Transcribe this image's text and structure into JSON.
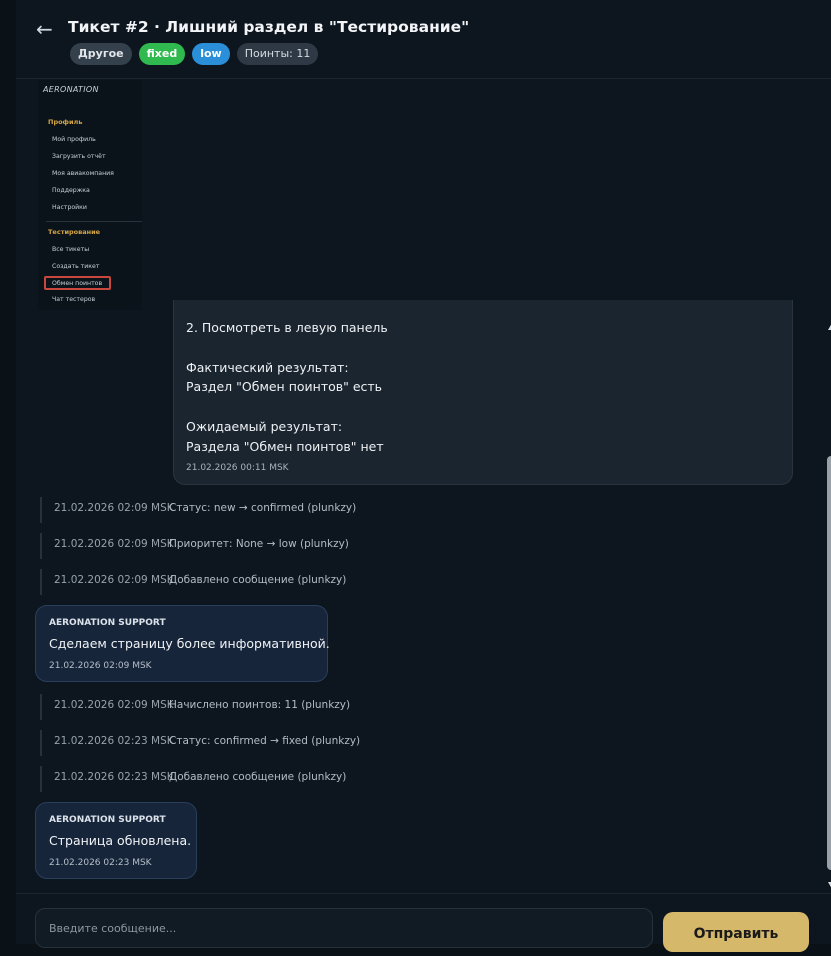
{
  "header": {
    "back_icon": "arrow-left-icon",
    "back_glyph": "←",
    "title": "Тикет #2 · Лишний раздел в \"Тестирование\"",
    "badges": {
      "category": "Другое",
      "status": "fixed",
      "priority": "low",
      "points": "Поинты: 11"
    }
  },
  "attachment": {
    "logo": "AERONATION",
    "section_profile": "Профиль",
    "profile_items": [
      "Мой профиль",
      "Загрузить отчёт",
      "Моя авиакомпания",
      "Поддержка",
      "Настройки"
    ],
    "section_testing": "Тестирование",
    "testing_items": [
      "Все тикеты",
      "Создать тикет",
      "Обмен поинтов",
      "Чат тестеров"
    ]
  },
  "messages": {
    "user_first": {
      "lines": [
        "2. Посмотреть в левую панель",
        "Фактический результат:",
        "Раздел \"Обмен поинтов\" есть",
        "Ожидаемый результат:",
        "Раздела \"Обмен поинтов\" нет"
      ],
      "time": "21.02.2026 00:11 MSK"
    },
    "events_1": [
      {
        "time": "21.02.2026 02:09 MSK",
        "text": "Статус: new → confirmed (plunkzy)"
      },
      {
        "time": "21.02.2026 02:09 MSK",
        "text": "Приоритет: None → low (plunkzy)"
      },
      {
        "time": "21.02.2026 02:09 MSK",
        "text": "Добавлено сообщение (plunkzy)"
      }
    ],
    "support_1": {
      "author": "AERONATION SUPPORT",
      "text": "Сделаем страницу более информативной.",
      "time": "21.02.2026 02:09 MSK"
    },
    "events_2": [
      {
        "time": "21.02.2026 02:09 MSK",
        "text": "Начислено поинтов: 11 (plunkzy)"
      },
      {
        "time": "21.02.2026 02:23 MSK",
        "text": "Статус: confirmed → fixed (plunkzy)"
      },
      {
        "time": "21.02.2026 02:23 MSK",
        "text": "Добавлено сообщение (plunkzy)"
      }
    ],
    "support_2": {
      "author": "AERONATION SUPPORT",
      "text": "Страница обновлена.",
      "time": "21.02.2026 02:23 MSK"
    }
  },
  "composer": {
    "placeholder": "Введите сообщение...",
    "value": "",
    "send_label": "Отправить"
  },
  "colors": {
    "accent": "#d6b86a",
    "status_fixed": "#2fb94e",
    "priority_low": "#2a8fd8",
    "highlight": "#c9473d"
  }
}
